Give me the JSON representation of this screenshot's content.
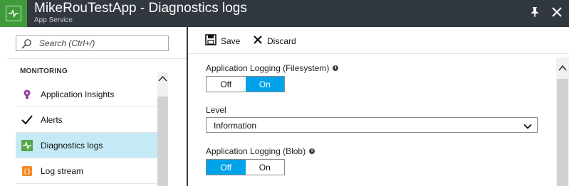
{
  "header": {
    "title": "MikeRouTestApp - Diagnostics logs",
    "subtitle": "App Service",
    "bg_color": "#32383f",
    "app_icon": "app-service-icon",
    "app_icon_color": "#3f9b3a"
  },
  "search": {
    "placeholder": "Search (Ctrl+/)"
  },
  "sidebar": {
    "section_label": "MONITORING",
    "items": [
      {
        "label": "Application Insights",
        "icon": "lightbulb-icon",
        "active": false
      },
      {
        "label": "Alerts",
        "icon": "checkmark-icon",
        "active": false
      },
      {
        "label": "Diagnostics logs",
        "icon": "diagnostics-icon",
        "active": true
      },
      {
        "label": "Log stream",
        "icon": "log-stream-icon",
        "active": false
      }
    ],
    "active_color": "#c5eaf6"
  },
  "toolbar": {
    "save_label": "Save",
    "discard_label": "Discard"
  },
  "settings": {
    "app_logging_fs": {
      "label": "Application Logging (Filesystem)",
      "options": [
        "Off",
        "On"
      ],
      "selected": "On"
    },
    "level": {
      "label": "Level",
      "value": "Information"
    },
    "app_logging_blob": {
      "label": "Application Logging (Blob)",
      "options": [
        "Off",
        "On"
      ],
      "selected": "Off"
    },
    "accent_color": "#00a3e8"
  }
}
